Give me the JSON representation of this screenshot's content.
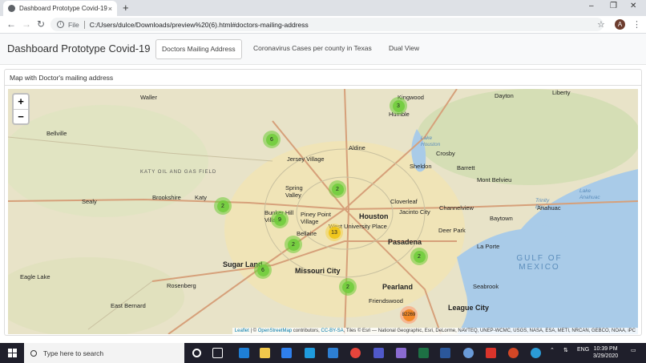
{
  "browser": {
    "tab_title": "Dashboard Prototype Covid-19",
    "tab_close": "×",
    "new_tab": "+",
    "url_scheme_label": "File",
    "url": "C:/Users/dulce/Downloads/preview%20(6).html#doctors-mailing-address",
    "avatar_letter": "A",
    "window_controls": [
      "–",
      "❐",
      "✕"
    ]
  },
  "navbar": {
    "brand": "Dashboard Prototype Covid-19",
    "links": [
      "Doctors Mailing Address",
      "Coronavirus Cases per county in Texas",
      "Dual View"
    ],
    "active_index": 0
  },
  "card": {
    "header": "Map with Doctor's mailing address"
  },
  "map": {
    "zoom_in": "+",
    "zoom_out": "−",
    "places": {
      "waller": "Waller",
      "bellville": "Bellville",
      "sealy": "Sealy",
      "brookshire": "Brookshire",
      "katy": "Katy",
      "jersey_village": "Jersey Village",
      "aldine": "Aldine",
      "humble": "Humble",
      "kingwood": "Kingwood",
      "dayton": "Dayton",
      "liberty": "Liberty",
      "crosby": "Crosby",
      "barrett": "Barrett",
      "sheldon": "Sheldon",
      "mont_belvieu": "Mont Belvieu",
      "spring_valley": "Spring Valley",
      "houston": "Houston",
      "bunker_hill": "Bunker Hill Village",
      "piney_point": "Piney Point Village",
      "bellaire": "Bellaire",
      "west_university": "West University Place",
      "cloverleaf": "Cloverleaf",
      "jacinto_city": "Jacinto City",
      "channelview": "Channelview",
      "baytown": "Baytown",
      "anahuac": "Anahuac",
      "deer_park": "Deer Park",
      "pasadena": "Pasadena",
      "la_porte": "La Porte",
      "sugar_land": "Sugar Land",
      "missouri_city": "Missouri City",
      "eagle_lake": "Eagle Lake",
      "rosenberg": "Rosenberg",
      "east_bernard": "East Bernard",
      "pearland": "Pearland",
      "friendswood": "Friendswood",
      "seabrook": "Seabrook",
      "league_city": "League City",
      "katy_oil_field": "KATY OIL AND GAS FIELD",
      "lake_houston": "Lake Houston",
      "trinity_bay": "Trinity Bay",
      "lake_anahuac": "Lake Anahuac",
      "gulf": "GULF OF MEXICO"
    },
    "clusters": [
      {
        "label": "6",
        "size": "small"
      },
      {
        "label": "3",
        "size": "small"
      },
      {
        "label": "2",
        "size": "small"
      },
      {
        "label": "2",
        "size": "small"
      },
      {
        "label": "9",
        "size": "small"
      },
      {
        "label": "2",
        "size": "small"
      },
      {
        "label": "13",
        "size": "med"
      },
      {
        "label": "2",
        "size": "small"
      },
      {
        "label": "6",
        "size": "small"
      },
      {
        "label": "2",
        "size": "small"
      },
      {
        "label": "82269",
        "size": "large"
      }
    ],
    "attribution": {
      "leaflet": "Leaflet",
      "sep1": " | © ",
      "osm": "OpenStreetMap",
      "mid": " contributors, ",
      "ccbysa": "CC-BY-SA",
      "tail": ", Tiles © Esri — National Geographic, Esri, DeLorme, NAVTEQ, UNEP-WCMC, USGS, NASA, ESA, METI, NRCAN, GEBCO, NOAA, iPC"
    }
  },
  "taskbar": {
    "search_placeholder": "Type here to search",
    "language": "ENG",
    "time": "10:39 PM",
    "date": "3/29/2020"
  },
  "colors": {
    "cluster_small": "#6ecc39",
    "cluster_med": "#f0c20c",
    "cluster_large": "#f18017",
    "water": "#a9cbe8",
    "land": "#e8e3c8"
  }
}
